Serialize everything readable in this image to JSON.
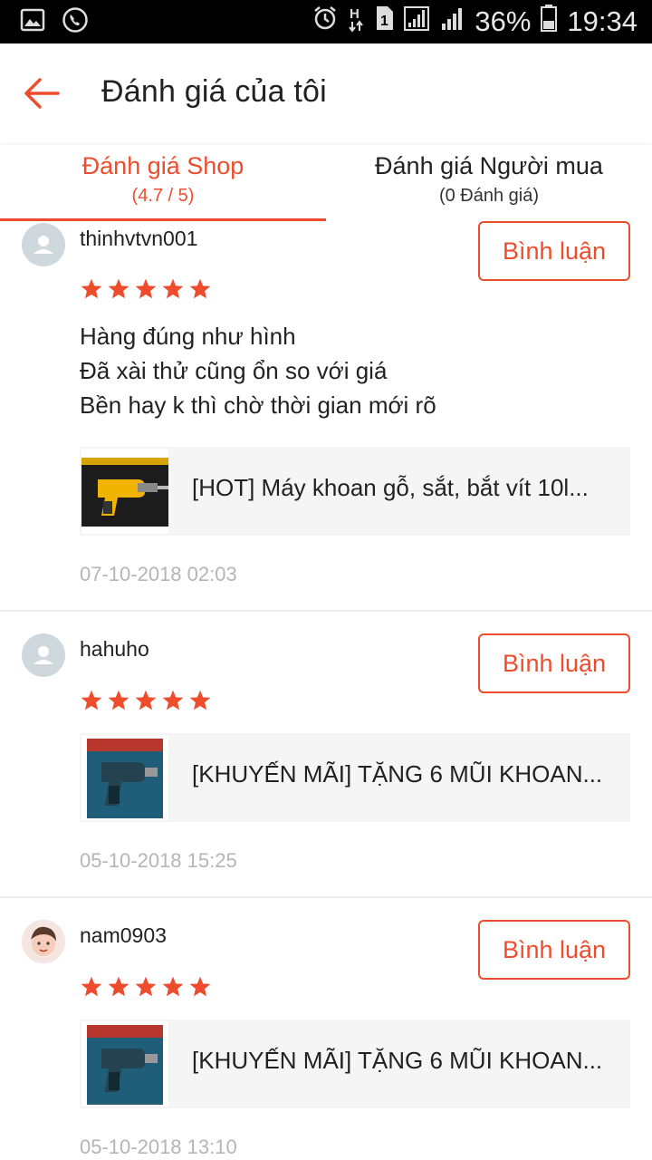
{
  "status_bar": {
    "icons_left": [
      "gallery-icon",
      "phone-call-icon"
    ],
    "icons_right": [
      "alarm-icon",
      "hplus-data-icon",
      "sim-1-icon",
      "signal-1-icon",
      "signal-2-icon"
    ],
    "battery_percent": "36%",
    "time": "19:34"
  },
  "header": {
    "title": "Đánh giá của tôi",
    "back_icon": "arrow-left-icon"
  },
  "tabs": [
    {
      "title": "Đánh giá Shop",
      "sub": "(4.7 / 5)",
      "active": true
    },
    {
      "title": "Đánh giá Người mua",
      "sub": "(0 Đánh giá)",
      "active": false
    }
  ],
  "colors": {
    "accent": "#ee4d2d",
    "date_gray": "#b5b5b5",
    "product_bg": "#f5f5f5"
  },
  "reviews": [
    {
      "username": "thinhvtvn001",
      "comment_label": "Bình luận",
      "rating": 5,
      "text_lines": [
        "Hàng đúng như hình",
        "Đã xài thử cũng ổn so với giá",
        "Bền hay k thì chờ thời gian mới rõ"
      ],
      "product_name": "[HOT] Máy khoan gỗ, sắt, bắt vít 10l...",
      "date": "07-10-2018 02:03"
    },
    {
      "username": "hahuho",
      "comment_label": "Bình luận",
      "rating": 5,
      "text_lines": [],
      "product_name": "[KHUYẾN MÃI] TẶNG 6 MŨI KHOAN...",
      "date": "05-10-2018 15:25"
    },
    {
      "username": "nam0903",
      "comment_label": "Bình luận",
      "rating": 5,
      "text_lines": [],
      "product_name": "[KHUYẾN MÃI] TẶNG 6 MŨI KHOAN...",
      "date": "05-10-2018 13:10"
    }
  ]
}
